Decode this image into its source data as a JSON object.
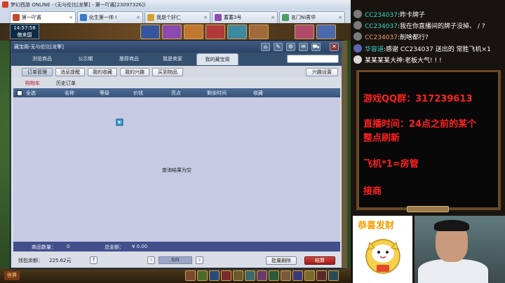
{
  "window": {
    "title": "梦幻西游 ONLINE - (无与伦比[龙擎] - 第一吖酱[23097326])",
    "tabs": [
      {
        "label": "第一吖酱",
        "close": "×"
      },
      {
        "label": "化生第一帅 I",
        "close": "×"
      },
      {
        "label": "我是个好仁",
        "close": "×"
      },
      {
        "label": "蓄蓄3号",
        "close": "×"
      },
      {
        "label": "名门Ni男华",
        "close": "×"
      }
    ]
  },
  "hud": {
    "clock": "14:57:58",
    "location": "傲来国"
  },
  "shop": {
    "title": "藏宝阁-无与伦比[龙擎]",
    "nav_tabs": [
      "浏览商品",
      "公示期",
      "推荐商品",
      "我是卖家",
      "我的藏宝阁"
    ],
    "active_nav": 4,
    "sub_buttons": [
      "订单管理",
      "消息提醒",
      "我的收藏",
      "我的兴趣",
      "买到物品"
    ],
    "interest_settings": "兴趣设置",
    "cart_tabs": [
      "购物车",
      "历史订单"
    ],
    "columns": {
      "select_all": "全选",
      "name": "名称",
      "level": "等级",
      "price": "价钱",
      "highlight": "亮点",
      "time_left": "剩余时间",
      "favorite": "收藏"
    },
    "empty_message": "查询结果为空",
    "summary": {
      "item_count_label": "商品数量：",
      "item_count": "0",
      "total_label": "总金额：",
      "total": "¥ 0.00"
    },
    "footer": {
      "wallet_label": "钱包余额：",
      "wallet": "225.62元",
      "help": "?",
      "prev": "‹",
      "page": "0/0",
      "next": "›",
      "batch_delete": "批量删除",
      "checkout": "结算"
    }
  },
  "bottom_bar": {
    "world": "世界"
  },
  "chat": [
    {
      "name": "CC234037",
      "text": ":昨卡牌子"
    },
    {
      "name": "CC234037",
      "text": ":我在你直播间的牌子没掉、 / ?"
    },
    {
      "name": "CC234037",
      "text": ":削啥都行?"
    },
    {
      "name": "华容道",
      "text": ":感谢 CC234037 送出的 常胜飞机×1"
    },
    {
      "name": "",
      "text": "某某某某大神:老板大气! ! !"
    }
  ],
  "info": {
    "qq_group": "游戏QQ群：317239613",
    "live_time_1": "直播时间：24点之前的某个",
    "live_time_2": "整点刷新",
    "plane": "飞机*1=房管",
    "contract": "接商"
  },
  "luck": {
    "title": "恭喜发财"
  },
  "colors": {
    "shop_header": "#2b4264",
    "chat_name": "#35d6c8",
    "info_text": "#ff2020",
    "checkout": "#b8261f",
    "active_cart_tab": "#b8161b"
  }
}
